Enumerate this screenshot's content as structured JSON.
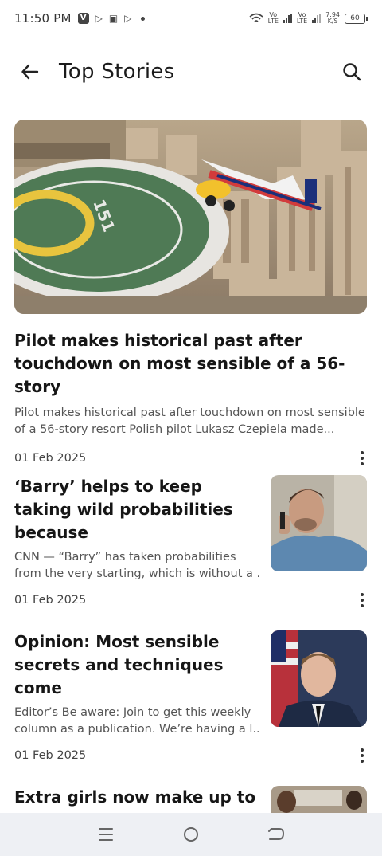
{
  "status": {
    "time": "11:50 PM",
    "net1": "Vo\nLTE",
    "net2": "Vo\nLTE",
    "speed_value": "7.94",
    "speed_unit": "K/S",
    "battery": "60"
  },
  "header": {
    "title": "Top Stories"
  },
  "hero": {
    "title": "Pilot makes historical past after touchdown on most sensible of a 56-story",
    "summary": "Pilot makes historical past after touchdown on most sensible of a 56-story resort Polish pilot Lukasz Czepiela made...",
    "date": "01 Feb 2025",
    "helipad_number": "151"
  },
  "stories": [
    {
      "title": "‘Barry’ helps to keep taking wild probabilities because",
      "summary_line1": "CNN  —  “Barry” has taken probabilities",
      "summary_line2": "from the very starting, which is without a ...",
      "date": "01 Feb 2025"
    },
    {
      "title": "Opinion: Most sensible secrets and techniques come",
      "summary_line1": "Editor’s Be aware: Join to get this weekly",
      "summary_line2": "column as a publication. We’re having a l...",
      "date": "01 Feb 2025"
    },
    {
      "title": "Extra girls now make up to"
    }
  ],
  "icons": {
    "back": "arrow-left-icon",
    "search": "search-icon",
    "more": "more-vert-icon",
    "nav_menu": "menu-icon",
    "nav_home": "home-circle-icon",
    "nav_back": "back-return-icon"
  }
}
